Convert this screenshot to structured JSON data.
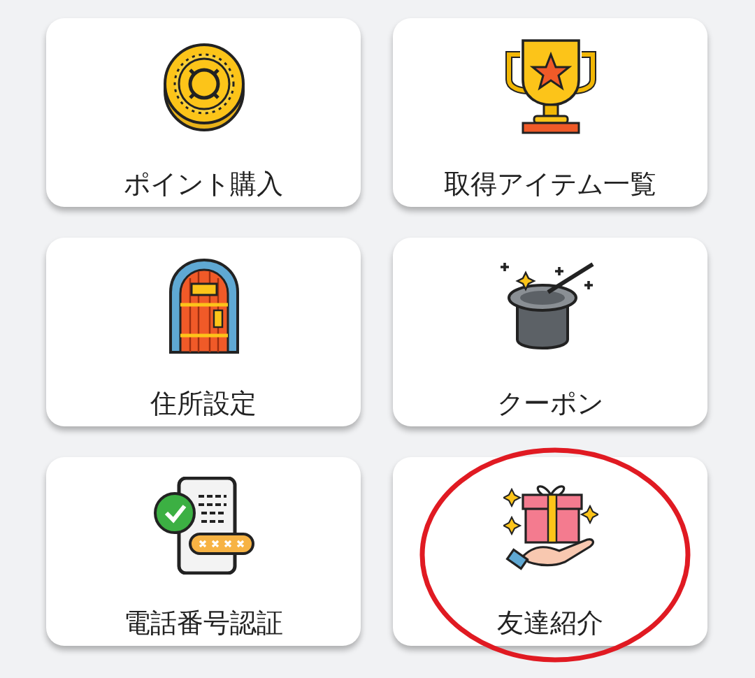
{
  "menu_items": [
    {
      "label": "ポイント購入",
      "circled": false
    },
    {
      "label": "取得アイテム一覧",
      "circled": false
    },
    {
      "label": "住所設定",
      "circled": false
    },
    {
      "label": "クーポン",
      "circled": false
    },
    {
      "label": "電話番号認証",
      "circled": false
    },
    {
      "label": "友達紹介",
      "circled": true
    }
  ]
}
